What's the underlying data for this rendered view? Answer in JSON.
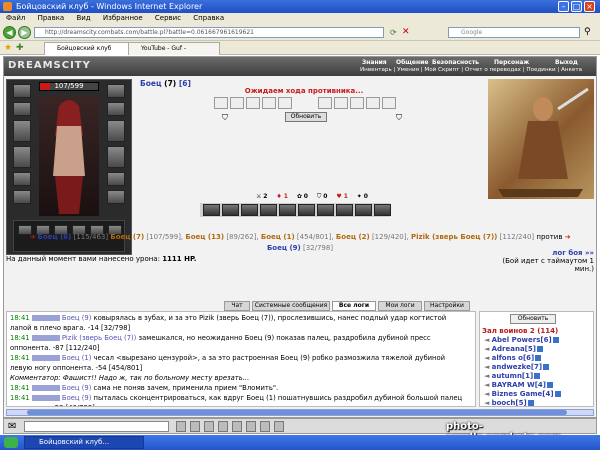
{
  "window": {
    "title": "Бойцовский клуб - Windows Internet Explorer"
  },
  "menu": [
    "Файл",
    "Правка",
    "Вид",
    "Избранное",
    "Сервис",
    "Справка"
  ],
  "address": {
    "url": "http://dreamscity.combats.com/battle.pl?battle=0.061667961619621",
    "search_placeholder": "Google"
  },
  "tabs": [
    {
      "label": "Бойцовский клуб",
      "active": true
    },
    {
      "label": "YouTube - Guf - Metropolitan..",
      "active": false
    }
  ],
  "game": {
    "logo": "DREAMSCITY",
    "menu": [
      "Знания",
      "Общение",
      "Безопасность",
      "Персонаж",
      "Выход"
    ],
    "submenu": "Инвентарь | Умения | Мой Скрипт | Отчет о переводах | Поединки | Анкета",
    "player": {
      "name": "Боец",
      "level": "(7)",
      "extra": "[6]",
      "hp": "107/599",
      "hp_fraction": 0.18
    },
    "waiting_text": "Ожидаем хода противника...",
    "refresh_label": "Обновить",
    "counters": [
      "2",
      "1",
      "0",
      "0",
      "1",
      "0"
    ],
    "teams_line1": [
      {
        "name": "Боец (6)",
        "hp": "[115/463]",
        "color": "bl"
      },
      {
        "name": "Боец (7)",
        "hp": "[107/599],",
        "color": "or"
      },
      {
        "name": "Боец (13)",
        "hp": "[89/262],",
        "color": "or"
      },
      {
        "name": "Боец (1)",
        "hp": "[454/801],",
        "color": "or"
      },
      {
        "name": "Боец (2)",
        "hp": "[129/420],",
        "color": "or"
      },
      {
        "name": "Pizik (зверь Боец (7))",
        "hp": "[112/240]",
        "color": "or"
      }
    ],
    "vs": "против",
    "teams_line2": [
      {
        "name": "Боец (9)",
        "hp": "[32/798]",
        "color": "bl"
      }
    ],
    "damage_label": "На данный момент вами нанесено урона:",
    "damage_value": "1111 HP.",
    "fight_log_link": "лог боя »»",
    "timeout_text": "(Бой идет с таймаутом 1 мин.)",
    "log_tabs": [
      "Чат",
      "Системные сообщения",
      "Все логи",
      "Мои логи",
      "Настройки"
    ],
    "chat": [
      {
        "time": "18:41",
        "who": "Боец (9)",
        "text": "ковырялась в зубах, и за это Pizik (зверь Боец (7)), прослезившись, нанес подлый удар когтистой"
      },
      {
        "time": "",
        "who": "",
        "text": "лапой в плечо врага. -14 [32/798]"
      },
      {
        "time": "18:41",
        "who": "Pizik (зверь Боец (7))",
        "text": "замешкался, но неожиданно Боец (9) показав палец, раздробила дубиной пресс"
      },
      {
        "time": "",
        "who": "",
        "text": "оппонента. -87 [112/240]"
      },
      {
        "time": "18:41",
        "who": "Боец (1)",
        "text": "чесал <вырезано цензурой>, а за это растроенная Боец (9) робко размозжила тяжелой дубиной"
      },
      {
        "time": "",
        "who": "",
        "text": "левую ногу оппонента. -54 [454/801]"
      },
      {
        "time": "",
        "who": "",
        "text": "Комментатор: Фашист!! Надо ж, так по больному месту врезать..."
      },
      {
        "time": "18:41",
        "who": "Боец (9)",
        "text": "сама не поняв зачем, применила прием \"Вломить\"."
      },
      {
        "time": "18:41",
        "who": "Боец (9)",
        "text": "пыталась сконцентрироваться, как вдруг Боец (1) пошатнувшись раздробил дубиной большой палец"
      },
      {
        "time": "",
        "who": "",
        "text": "соперника. -53 [46/798]"
      },
      {
        "time": "18:41",
        "who": "Боец (9)",
        "text": "поняла, что ситуация становится критической, применил прием \"Сильный удар\"."
      }
    ],
    "side_refresh": "Обновить",
    "room_title": "Зал воинов 2 (114)",
    "players": [
      "Abel Powers[6]",
      "Adreana[5]",
      "alfons o[6]",
      "andwezke[7]",
      "autumn[1]",
      "BAYRAM W[4]",
      "Biznes Game[4]",
      "booch[5]"
    ]
  },
  "watermark": "photo-scrolls.combats.com",
  "taskbar": {
    "item": "Бойцовский клуб..."
  }
}
